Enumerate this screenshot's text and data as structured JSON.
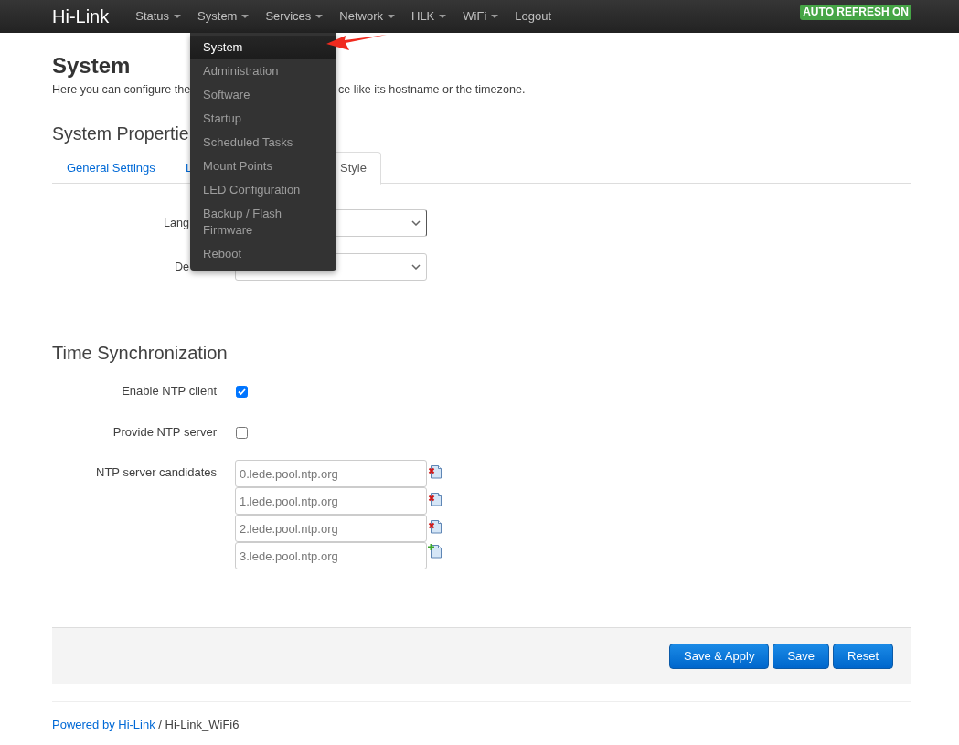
{
  "navbar": {
    "brand": "Hi-Link",
    "items": [
      {
        "label": "Status",
        "kind": "dropdown"
      },
      {
        "label": "System",
        "kind": "dropdown",
        "menu": [
          {
            "label": "System",
            "selected": true
          },
          {
            "label": "Administration",
            "selected": false
          },
          {
            "label": "Software",
            "selected": false
          },
          {
            "label": "Startup",
            "selected": false
          },
          {
            "label": "Scheduled Tasks",
            "selected": false
          },
          {
            "label": "Mount Points",
            "selected": false
          },
          {
            "label": "LED Configuration",
            "selected": false
          },
          {
            "label": "Backup / Flash Firmware",
            "selected": false
          },
          {
            "label": "Reboot",
            "selected": false
          }
        ]
      },
      {
        "label": "Services",
        "kind": "dropdown"
      },
      {
        "label": "Network",
        "kind": "dropdown"
      },
      {
        "label": "HLK",
        "kind": "dropdown"
      },
      {
        "label": "WiFi",
        "kind": "dropdown"
      },
      {
        "label": "Logout",
        "kind": "link"
      }
    ],
    "badge": "AUTO REFRESH ON"
  },
  "annotations": [
    {
      "kind": "arrow"
    }
  ],
  "page": {
    "title": "System",
    "description": [
      "Here you can configure the",
      "ce like its hostname or the timezone."
    ]
  },
  "system_properties": {
    "heading": "System Propertie",
    "tabs": [
      {
        "label": "General Settings",
        "selected": false
      },
      {
        "label": "L",
        "selected": false
      },
      {
        "label": "Style",
        "selected": true
      }
    ],
    "fields": [
      {
        "label": "Lang",
        "focused": true
      },
      {
        "label": "De",
        "focused": false
      }
    ]
  },
  "time_synchronization": {
    "heading": "Time Synchronization",
    "options": [
      {
        "label": "Enable NTP client",
        "checked": true
      },
      {
        "label": "Provide NTP server",
        "checked": false
      }
    ],
    "server_candidates": {
      "label": "NTP server candidates",
      "entries": [
        {
          "value": "0.lede.pool.ntp.org",
          "kind": "remove"
        },
        {
          "value": "1.lede.pool.ntp.org",
          "kind": "remove"
        },
        {
          "value": "2.lede.pool.ntp.org",
          "kind": "remove"
        },
        {
          "value": "3.lede.pool.ntp.org",
          "kind": "add"
        }
      ]
    }
  },
  "actions": [
    "Save & Apply",
    "Save",
    "Reset"
  ],
  "footer": {
    "link": "Powered by Hi-Link",
    "text": "/ Hi-Link_WiFi6"
  }
}
